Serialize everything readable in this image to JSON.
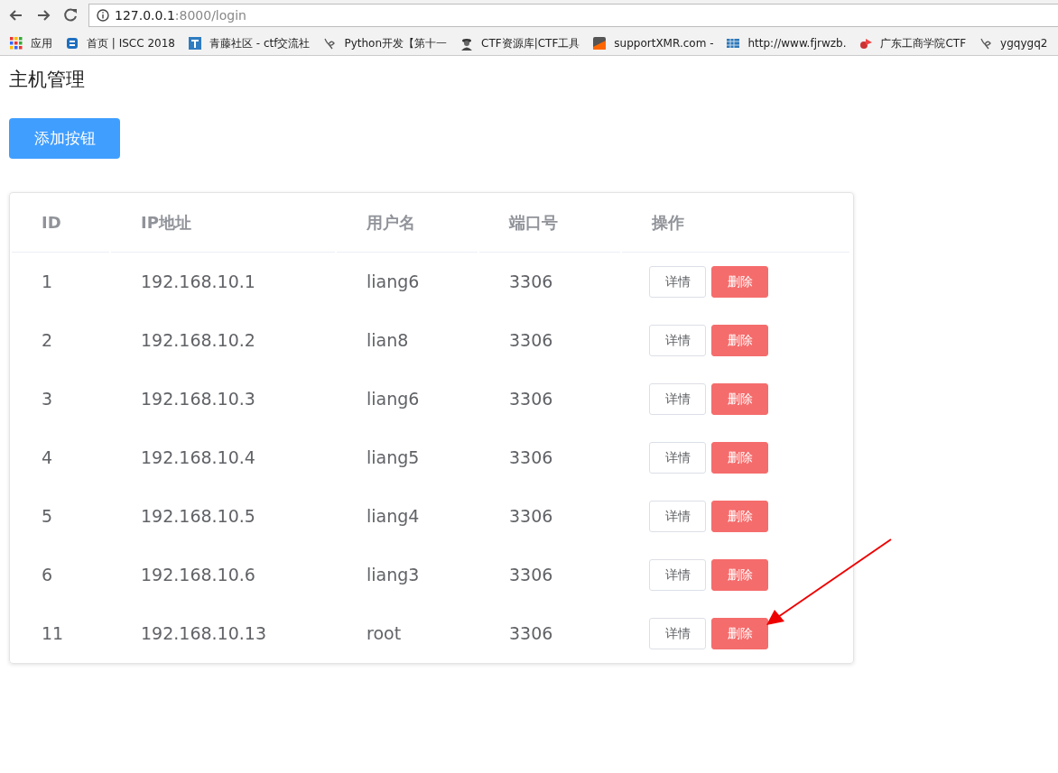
{
  "browser": {
    "url_host": "127.0.0.1",
    "url_rest": ":8000/login",
    "bookmarks": [
      {
        "label": "应用",
        "kind": "apps"
      },
      {
        "label": "首页 | ISCC 2018",
        "kind": "site"
      },
      {
        "label": "青藤社区 - ctf交流社",
        "kind": "tile"
      },
      {
        "label": "Python开发【第十一",
        "kind": "swirl"
      },
      {
        "label": "CTF资源库|CTF工具",
        "kind": "person"
      },
      {
        "label": "supportXMR.com -",
        "kind": "square"
      },
      {
        "label": "http://www.fjrwzb.",
        "kind": "grid"
      },
      {
        "label": "广东工商学院CTF",
        "kind": "flag"
      },
      {
        "label": "ygqygq2",
        "kind": "swirl"
      }
    ]
  },
  "page": {
    "title": "主机管理",
    "add_button": "添加按钮",
    "table": {
      "columns": [
        "ID",
        "IP地址",
        "用户名",
        "端口号",
        "操作"
      ],
      "rows": [
        {
          "id": "1",
          "ip": "192.168.10.1",
          "user": "liang6",
          "port": "3306",
          "actions": [
            "详情",
            "删除"
          ]
        },
        {
          "id": "2",
          "ip": "192.168.10.2",
          "user": "lian8",
          "port": "3306",
          "actions": [
            "详情",
            "删除"
          ]
        },
        {
          "id": "3",
          "ip": "192.168.10.3",
          "user": "liang6",
          "port": "3306",
          "actions": [
            "详情",
            "删除"
          ]
        },
        {
          "id": "4",
          "ip": "192.168.10.4",
          "user": "liang5",
          "port": "3306",
          "actions": [
            "详情",
            "删除"
          ]
        },
        {
          "id": "5",
          "ip": "192.168.10.5",
          "user": "liang4",
          "port": "3306",
          "actions": [
            "详情",
            "删除"
          ]
        },
        {
          "id": "6",
          "ip": "192.168.10.6",
          "user": "liang3",
          "port": "3306",
          "actions": [
            "详情",
            "删除"
          ]
        },
        {
          "id": "11",
          "ip": "192.168.10.13",
          "user": "root",
          "port": "3306",
          "actions": [
            "详情",
            "删除"
          ]
        }
      ]
    }
  }
}
